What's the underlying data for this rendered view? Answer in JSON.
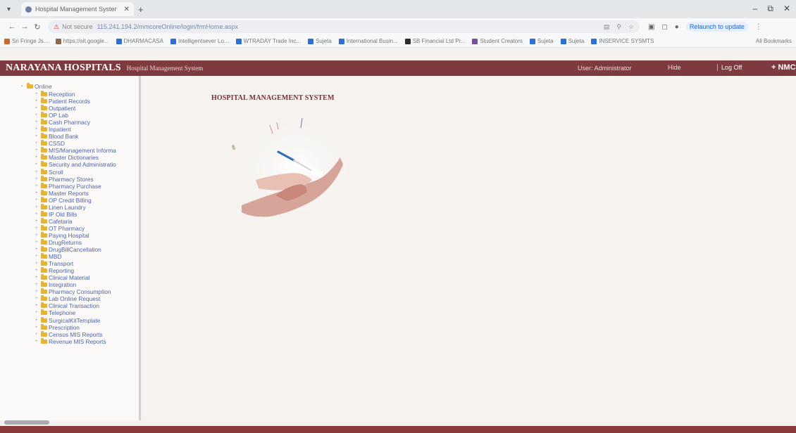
{
  "browser": {
    "tab_title": "Hospital Management Syster",
    "url": "115.241.194.2/mmcoreOnline/login/frmHome.aspx",
    "not_secure": "Not secure",
    "relaunch_label": "Relaunch to update",
    "bookmarks": [
      {
        "label": "Sri Fringe Js...",
        "color": "#c76a2c"
      },
      {
        "label": "https://sit.google...",
        "color": "#8a6a4a"
      },
      {
        "label": "DHARMACASA",
        "color": "#2e6fd1"
      },
      {
        "label": "Intelligentsever Lo...",
        "color": "#2e6fd1"
      },
      {
        "label": "WTRADAY Trade Inc...",
        "color": "#2e6fd1"
      },
      {
        "label": "Sujeta",
        "color": "#2e6fd1"
      },
      {
        "label": "International Busin...",
        "color": "#2e6fd1"
      },
      {
        "label": "SB Financial Ltd Pr...",
        "color": "#2c2c2c"
      },
      {
        "label": "Student Creators",
        "color": "#7a4fa0"
      },
      {
        "label": "Sujeta",
        "color": "#2e6fd1"
      },
      {
        "label": "Sujeta",
        "color": "#2e6fd1"
      },
      {
        "label": "INSERVICE SYSMTS",
        "color": "#2e6fd1"
      }
    ],
    "all_bookmarks": "All Bookmarks"
  },
  "header": {
    "brand": "NARAYANA HOSPITALS",
    "subtitle": "Hospital Management System",
    "user": "User: Administrator",
    "hide": "Hide",
    "logoff": "Log Off",
    "nmc": "+ NMC"
  },
  "sidebar": {
    "root": "Online",
    "items": [
      "Reception",
      "Patient Records",
      "Outpatient",
      "OP Lab",
      "Cash Pharmacy",
      "Inpatient",
      "Blood Bank",
      "CSSD",
      "MIS/Management Informa",
      "Master Dictionaries",
      "Security and Administratio",
      "Scroll",
      "Pharmacy Stores",
      "Pharmacy Purchase",
      "Master Reports",
      "OP Credit Billing",
      "Linen Laundry",
      "IP Old Bills",
      "Cafetaria",
      "OT Pharmacy",
      "Paying Hospital",
      "DrugReturns",
      "DrugBillCancellation",
      "MBD",
      "Transport",
      "Reporting",
      "Clinical Material",
      "Integration",
      "Pharmacy Consumption",
      "Lab Online Request",
      "Clinical Transaction",
      "Telephone",
      "SurgicalKitTemplate",
      "Prescription",
      "Census MIS Reports",
      "Revenue MIS Reports"
    ]
  },
  "main": {
    "title": "HOSPITAL MANAGEMENT SYSTEM"
  },
  "colors": {
    "header_bg": "#7e3b3f",
    "title_color": "#7a2c30",
    "link_color": "#4f63a6",
    "folder": "#e4b33b"
  }
}
